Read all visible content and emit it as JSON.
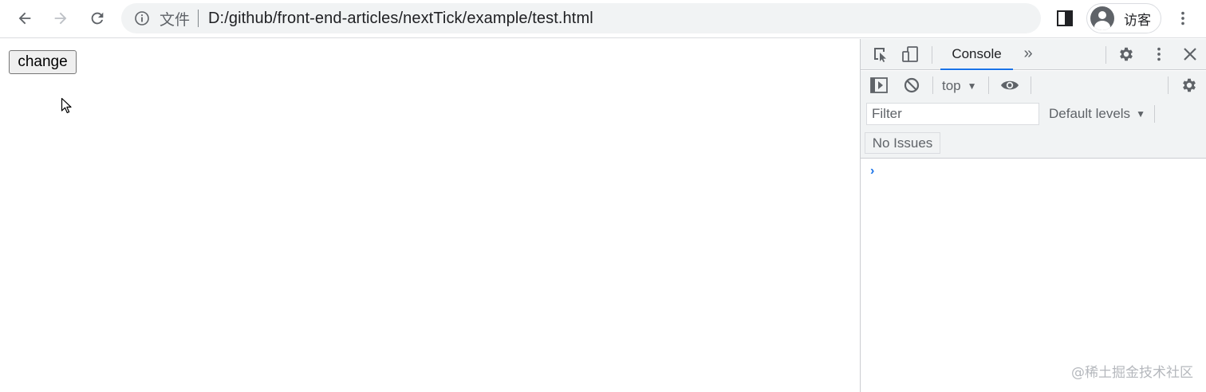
{
  "browser": {
    "scheme_label": "文件",
    "url": "D:/github/front-end-articles/nextTick/example/test.html",
    "profile_label": "访客"
  },
  "page": {
    "change_button_label": "change"
  },
  "devtools": {
    "tabs": [
      {
        "label": "Console",
        "active": true
      }
    ],
    "more_tabs_glyph": "»",
    "context": "top",
    "filter_placeholder": "Filter",
    "levels_label": "Default levels",
    "issues_label": "No Issues",
    "prompt_glyph": "›"
  },
  "watermark": "@稀土掘金技术社区",
  "colors": {
    "accent": "#1a73e8",
    "toolbar_bg": "#f1f3f4",
    "icon_gray": "#5f6368"
  }
}
